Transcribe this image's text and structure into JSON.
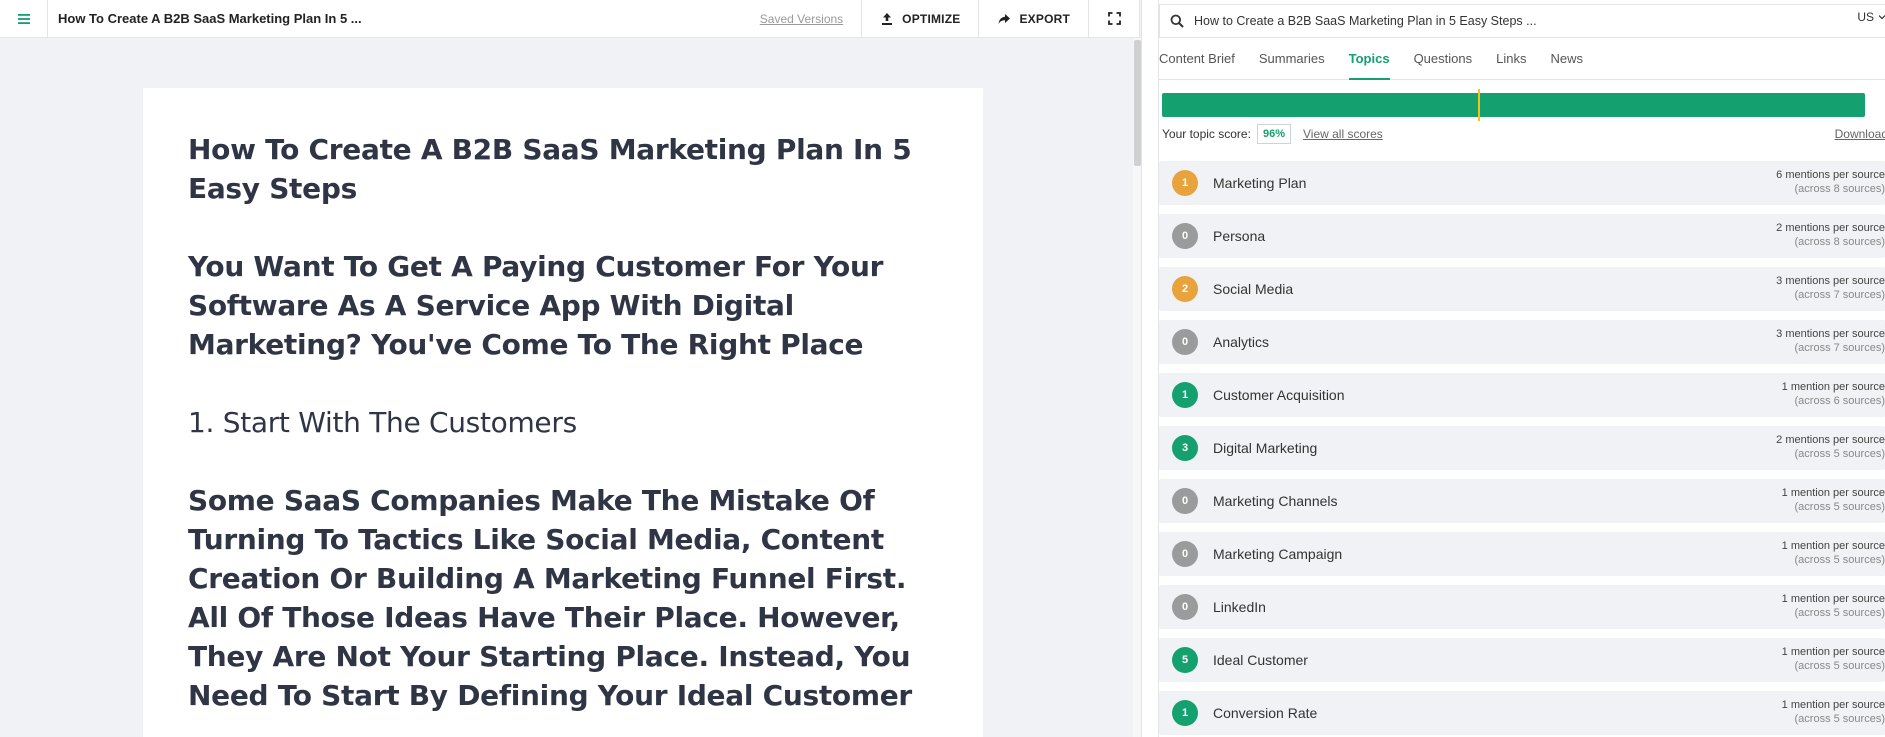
{
  "editor": {
    "doc_title": "How To Create A B2B SaaS Marketing Plan In 5 ...",
    "saved_versions": "Saved Versions",
    "optimize_label": "OPTIMIZE",
    "export_label": "EXPORT",
    "headings": [
      "How To Create A B2B SaaS Marketing Plan In 5 Easy Steps",
      "You Want To Get A Paying Customer For Your Software As A Service App With Digital Marketing? You've Come To The Right Place",
      "1. Start With The Customers",
      "Some SaaS Companies Make The Mistake Of Turning To Tactics Like Social Media, Content Creation Or Building A Marketing Funnel First. All Of Those Ideas Have Their Place. However, They Are Not Your Starting Place. Instead, You Need To Start By Defining Your Ideal Customer"
    ]
  },
  "sidebar": {
    "search_query": "How to Create a B2B SaaS Marketing Plan in 5 Easy Steps ...",
    "country": "US",
    "tabs": [
      "Content Brief",
      "Summaries",
      "Topics",
      "Questions",
      "Links",
      "News"
    ],
    "active_tab": "Topics",
    "score_label": "Your topic score:",
    "score_value": "96%",
    "score_fraction": 0.96,
    "view_all_scores": "View all scores",
    "download": "Download",
    "colors": {
      "accent": "#14a06f",
      "orange": "#e8a33c",
      "gray": "#9a9b9d",
      "marker": "#f0c419"
    },
    "topics": [
      {
        "count": "1",
        "color": "orange",
        "name": "Marketing Plan",
        "mentions": "6 mentions per source",
        "sources": "(across 8 sources)"
      },
      {
        "count": "0",
        "color": "gray",
        "name": "Persona",
        "mentions": "2 mentions per source",
        "sources": "(across 8 sources)"
      },
      {
        "count": "2",
        "color": "orange",
        "name": "Social Media",
        "mentions": "3 mentions per source",
        "sources": "(across 7 sources)"
      },
      {
        "count": "0",
        "color": "gray",
        "name": "Analytics",
        "mentions": "3 mentions per source",
        "sources": "(across 7 sources)"
      },
      {
        "count": "1",
        "color": "green",
        "name": "Customer Acquisition",
        "mentions": "1 mention per source",
        "sources": "(across 6 sources)"
      },
      {
        "count": "3",
        "color": "green",
        "name": "Digital Marketing",
        "mentions": "2 mentions per source",
        "sources": "(across 5 sources)"
      },
      {
        "count": "0",
        "color": "gray",
        "name": "Marketing Channels",
        "mentions": "1 mention per source",
        "sources": "(across 5 sources)"
      },
      {
        "count": "0",
        "color": "gray",
        "name": "Marketing Campaign",
        "mentions": "1 mention per source",
        "sources": "(across 5 sources)"
      },
      {
        "count": "0",
        "color": "gray",
        "name": "LinkedIn",
        "mentions": "1 mention per source",
        "sources": "(across 5 sources)"
      },
      {
        "count": "5",
        "color": "green",
        "name": "Ideal Customer",
        "mentions": "1 mention per source",
        "sources": "(across 5 sources)"
      },
      {
        "count": "1",
        "color": "green",
        "name": "Conversion Rate",
        "mentions": "1 mention per source",
        "sources": "(across 5 sources)"
      }
    ]
  }
}
